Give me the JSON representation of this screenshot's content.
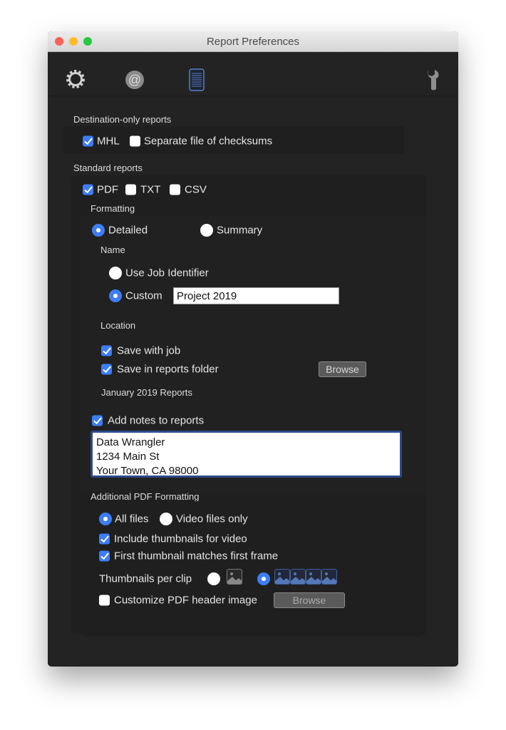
{
  "window": {
    "title": "Report Preferences"
  },
  "toolbar": {
    "icons": [
      "gear-icon",
      "at-sign-icon",
      "report-document-icon",
      "wrench-icon"
    ],
    "selected": "report-document-icon",
    "accent": "#3d7ef6"
  },
  "destination": {
    "heading": "Destination-only reports",
    "mhl": {
      "label": "MHL",
      "checked": true
    },
    "checksums": {
      "label": "Separate file of checksums",
      "checked": false
    }
  },
  "standard": {
    "heading": "Standard reports",
    "pdf": {
      "label": "PDF",
      "checked": true
    },
    "txt": {
      "label": "TXT",
      "checked": false
    },
    "csv": {
      "label": "CSV",
      "checked": false
    },
    "formatting": {
      "heading": "Formatting",
      "detailed": {
        "label": "Detailed",
        "selected": true
      },
      "summary": {
        "label": "Summary",
        "selected": false
      }
    },
    "name": {
      "heading": "Name",
      "job_identifier": {
        "label": "Use Job Identifier",
        "selected": false
      },
      "custom": {
        "label": "Custom",
        "selected": true,
        "value": "Project 2019"
      }
    },
    "location": {
      "heading": "Location",
      "save_with_job": {
        "label": "Save with job",
        "checked": true
      },
      "save_in_folder": {
        "label": "Save in reports folder",
        "checked": true
      },
      "browse": "Browse",
      "folder_name": "January 2019 Reports"
    },
    "notes": {
      "label": "Add notes to reports",
      "checked": true,
      "lines": [
        "Data Wrangler",
        "1234 Main St",
        "Your Town, CA 98000"
      ]
    }
  },
  "additional": {
    "heading": "Additional PDF Formatting",
    "all_files": {
      "label": "All files",
      "selected": true
    },
    "video_only": {
      "label": "Video files only",
      "selected": false
    },
    "include_thumbs": {
      "label": "Include thumbnails for video",
      "checked": true
    },
    "first_thumb": {
      "label": "First thumbnail matches first frame",
      "checked": true
    },
    "thumbs_per_clip": {
      "label": "Thumbnails per clip",
      "options": [
        1,
        4
      ],
      "selected": 4
    },
    "custom_header": {
      "label": "Customize PDF header image",
      "checked": false
    },
    "browse": "Browse"
  }
}
